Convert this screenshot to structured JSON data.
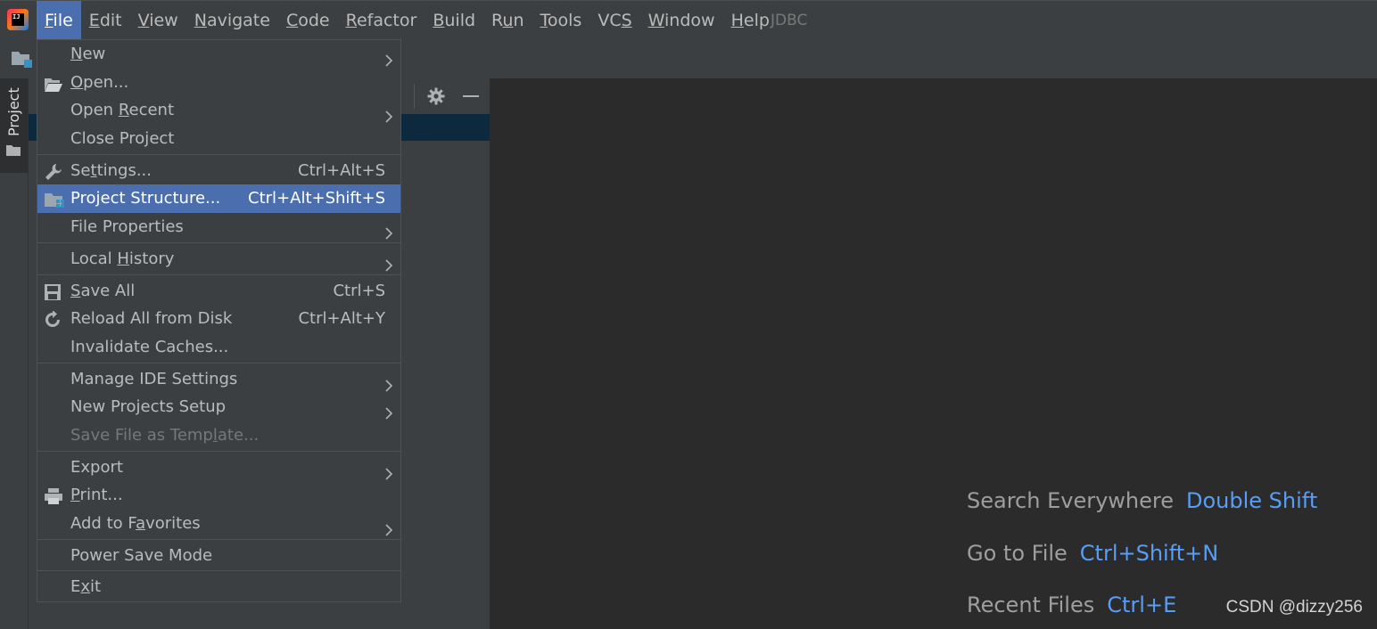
{
  "app": {
    "logo_text": "IJ"
  },
  "menubar": {
    "items": [
      {
        "pre": "",
        "u": "F",
        "post": "ile"
      },
      {
        "pre": "",
        "u": "E",
        "post": "dit"
      },
      {
        "pre": "",
        "u": "V",
        "post": "iew"
      },
      {
        "pre": "",
        "u": "N",
        "post": "avigate"
      },
      {
        "pre": "",
        "u": "C",
        "post": "ode"
      },
      {
        "pre": "",
        "u": "R",
        "post": "efactor"
      },
      {
        "pre": "",
        "u": "B",
        "post": "uild"
      },
      {
        "pre": "R",
        "u": "u",
        "post": "n"
      },
      {
        "pre": "",
        "u": "T",
        "post": "ools"
      },
      {
        "pre": "VC",
        "u": "S",
        "post": ""
      },
      {
        "pre": "",
        "u": "W",
        "post": "indow"
      },
      {
        "pre": "",
        "u": "H",
        "post": "elp"
      }
    ],
    "project_name": "JDBC"
  },
  "sidebar": {
    "project_tab": "Project"
  },
  "file_menu": {
    "groups": [
      [
        {
          "pre": "",
          "u": "N",
          "post": "ew",
          "shortcut": "",
          "submenu": true,
          "icon": ""
        },
        {
          "pre": "",
          "u": "O",
          "post": "pen...",
          "shortcut": "",
          "submenu": false,
          "icon": "open-folder-icon"
        },
        {
          "pre": "Open ",
          "u": "R",
          "post": "ecent",
          "shortcut": "",
          "submenu": true,
          "icon": ""
        },
        {
          "pre": "Close Project",
          "u": "",
          "post": "",
          "shortcut": "",
          "submenu": false,
          "icon": ""
        }
      ],
      [
        {
          "pre": "Se",
          "u": "t",
          "post": "tings...",
          "shortcut": "Ctrl+Alt+S",
          "submenu": false,
          "icon": "wrench-icon"
        },
        {
          "pre": "Project Structure...",
          "u": "",
          "post": "",
          "shortcut": "Ctrl+Alt+Shift+S",
          "submenu": false,
          "icon": "project-structure-icon",
          "selected": true
        },
        {
          "pre": "File Properties",
          "u": "",
          "post": "",
          "shortcut": "",
          "submenu": true,
          "icon": ""
        }
      ],
      [
        {
          "pre": "Local ",
          "u": "H",
          "post": "istory",
          "shortcut": "",
          "submenu": true,
          "icon": ""
        }
      ],
      [
        {
          "pre": "",
          "u": "S",
          "post": "ave All",
          "shortcut": "Ctrl+S",
          "submenu": false,
          "icon": "save-icon"
        },
        {
          "pre": "Reload All from Disk",
          "u": "",
          "post": "",
          "shortcut": "Ctrl+Alt+Y",
          "submenu": false,
          "icon": "reload-icon"
        },
        {
          "pre": "Invalidate Caches...",
          "u": "",
          "post": "",
          "shortcut": "",
          "submenu": false,
          "icon": ""
        }
      ],
      [
        {
          "pre": "Manage IDE Settings",
          "u": "",
          "post": "",
          "shortcut": "",
          "submenu": true,
          "icon": ""
        },
        {
          "pre": "New Projects Setup",
          "u": "",
          "post": "",
          "shortcut": "",
          "submenu": true,
          "icon": ""
        },
        {
          "pre": "Save File as Temp",
          "u": "l",
          "post": "ate...",
          "shortcut": "",
          "submenu": false,
          "icon": "",
          "disabled": true
        }
      ],
      [
        {
          "pre": "Export",
          "u": "",
          "post": "",
          "shortcut": "",
          "submenu": true,
          "icon": ""
        },
        {
          "pre": "",
          "u": "P",
          "post": "rint...",
          "shortcut": "",
          "submenu": false,
          "icon": "printer-icon"
        },
        {
          "pre": "Add to F",
          "u": "a",
          "post": "vorites",
          "shortcut": "",
          "submenu": true,
          "icon": ""
        }
      ],
      [
        {
          "pre": "Power Save Mode",
          "u": "",
          "post": "",
          "shortcut": "",
          "submenu": false,
          "icon": ""
        }
      ],
      [
        {
          "pre": "E",
          "u": "x",
          "post": "it",
          "shortcut": "",
          "submenu": false,
          "icon": ""
        }
      ]
    ]
  },
  "editor_hints": [
    {
      "label": "Search Everywhere",
      "key": "Double Shift"
    },
    {
      "label": "Go to File",
      "key": "Ctrl+Shift+N"
    },
    {
      "label": "Recent Files",
      "key": "Ctrl+E"
    }
  ],
  "watermark": "CSDN @dizzy256",
  "colors": {
    "accent": "#4b6eaf",
    "menubar_bg": "#3c3f41",
    "editor_bg": "#2b2b2b",
    "hint_key": "#589df6"
  }
}
